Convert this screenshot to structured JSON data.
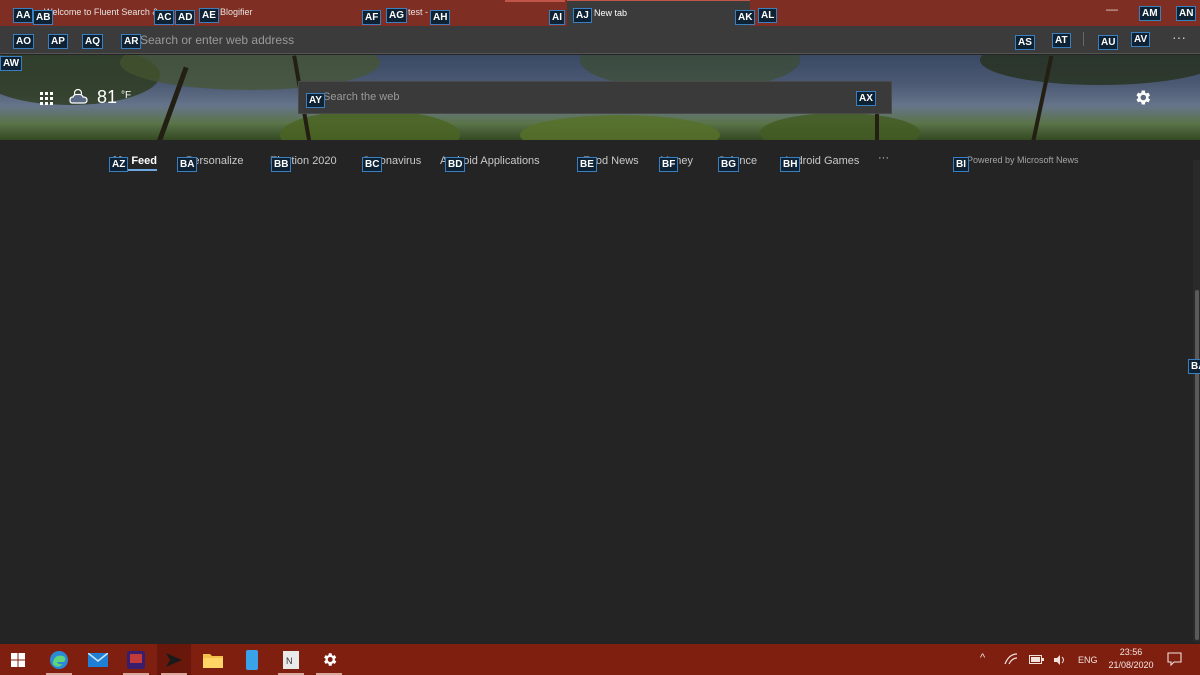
{
  "tabs": [
    {
      "title": "Welcome to Fluent Search & ..."
    },
    {
      "title": "Blogifier"
    },
    {
      "title": "test - ..."
    },
    {
      "title": "New tab"
    }
  ],
  "toolbar": {
    "address_placeholder": "Search or enter web address",
    "more_label": "···"
  },
  "weather": {
    "temperature": "81",
    "unit": "°F",
    "icon": "partly-cloudy-icon"
  },
  "search": {
    "placeholder": "Search the web"
  },
  "feed_nav": {
    "items": [
      "My Feed",
      "Personalize",
      "Election 2020",
      "Coronavirus",
      "Android Applications",
      "Food News",
      "Money",
      "Science",
      "Android Games"
    ],
    "more_label": "···",
    "powered_by": "Powered by Microsoft News"
  },
  "taskbar": {
    "language": "ENG",
    "time": "23:56",
    "date": "21/08/2020"
  },
  "hints": {
    "tabstrip": [
      "AA",
      "AB",
      "AC",
      "AD",
      "AE",
      "AF",
      "AG",
      "AH",
      "AI",
      "AJ",
      "AK",
      "AL",
      "AM",
      "AN"
    ],
    "toolbar": [
      "AO",
      "AP",
      "AQ",
      "AR",
      "AS",
      "AT",
      "AU",
      "AV"
    ],
    "page": [
      "AW",
      "AX",
      "AY"
    ],
    "nav": [
      "AZ",
      "BA",
      "BB",
      "BC",
      "BD",
      "BE",
      "BF",
      "BG",
      "BH",
      "BI"
    ],
    "scroll": "BA"
  },
  "colors": {
    "tabstrip": "#7e2e23",
    "taskbar": "#7e1f10",
    "page_background": "#242424",
    "hint_border": "#3a7fc0",
    "nav_active_underline": "#6fa7e0"
  }
}
